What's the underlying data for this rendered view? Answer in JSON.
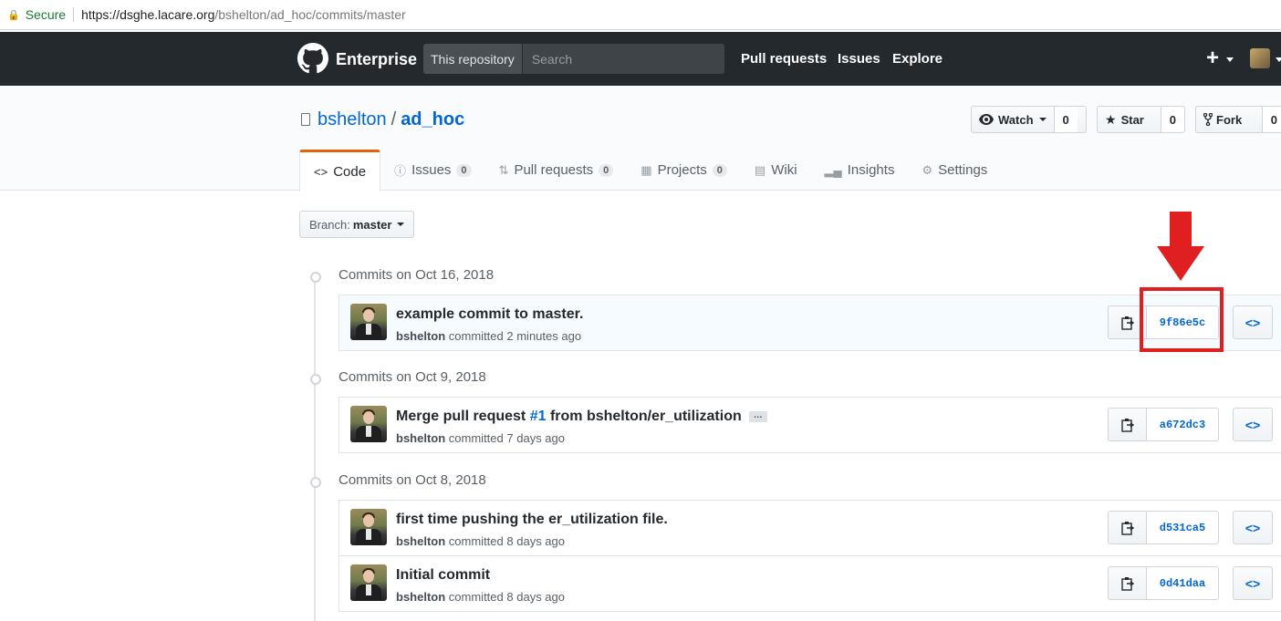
{
  "browser": {
    "secure_label": "Secure",
    "url_host": "https://dsghe.lacare.org",
    "url_path": "/bshelton/ad_hoc/commits/master"
  },
  "header": {
    "brand": "Enterprise",
    "search_scope": "This repository",
    "search_placeholder": "Search",
    "nav": [
      "Pull requests",
      "Issues",
      "Explore"
    ]
  },
  "repo": {
    "owner": "bshelton",
    "name": "ad_hoc",
    "watch_label": "Watch",
    "watch_count": "0",
    "star_label": "Star",
    "star_count": "0",
    "fork_label": "Fork",
    "fork_count": "0"
  },
  "tabs": [
    {
      "label": "Code",
      "icon": "code-icon"
    },
    {
      "label": "Issues",
      "icon": "issue-icon",
      "count": "0"
    },
    {
      "label": "Pull requests",
      "icon": "pull-request-icon",
      "count": "0"
    },
    {
      "label": "Projects",
      "icon": "project-icon",
      "count": "0"
    },
    {
      "label": "Wiki",
      "icon": "book-icon"
    },
    {
      "label": "Insights",
      "icon": "graph-icon"
    },
    {
      "label": "Settings",
      "icon": "gear-icon"
    }
  ],
  "branch": {
    "prefix": "Branch:",
    "value": "master"
  },
  "groups": [
    {
      "title": "Commits on Oct 16, 2018"
    },
    {
      "title": "Commits on Oct 9, 2018"
    },
    {
      "title": "Commits on Oct 8, 2018"
    }
  ],
  "commits": [
    {
      "message": "example commit to master.",
      "author": "bshelton",
      "verb": "committed",
      "time": "2 minutes ago",
      "sha": "9f86e5c"
    },
    {
      "message_pre": "Merge pull request ",
      "message_link": "#1",
      "message_post": " from bshelton/er_utilization",
      "ellipsis": "…",
      "author": "bshelton",
      "verb": "committed",
      "time": "7 days ago",
      "sha": "a672dc3"
    },
    {
      "message": "first time pushing the er_utilization file.",
      "author": "bshelton",
      "verb": "committed",
      "time": "8 days ago",
      "sha": "d531ca5"
    },
    {
      "message": "Initial commit",
      "author": "bshelton",
      "verb": "committed",
      "time": "8 days ago",
      "sha": "0d41daa"
    }
  ],
  "colors": {
    "annotation": "#e02020",
    "link": "#0366d6",
    "header": "#24292e"
  }
}
